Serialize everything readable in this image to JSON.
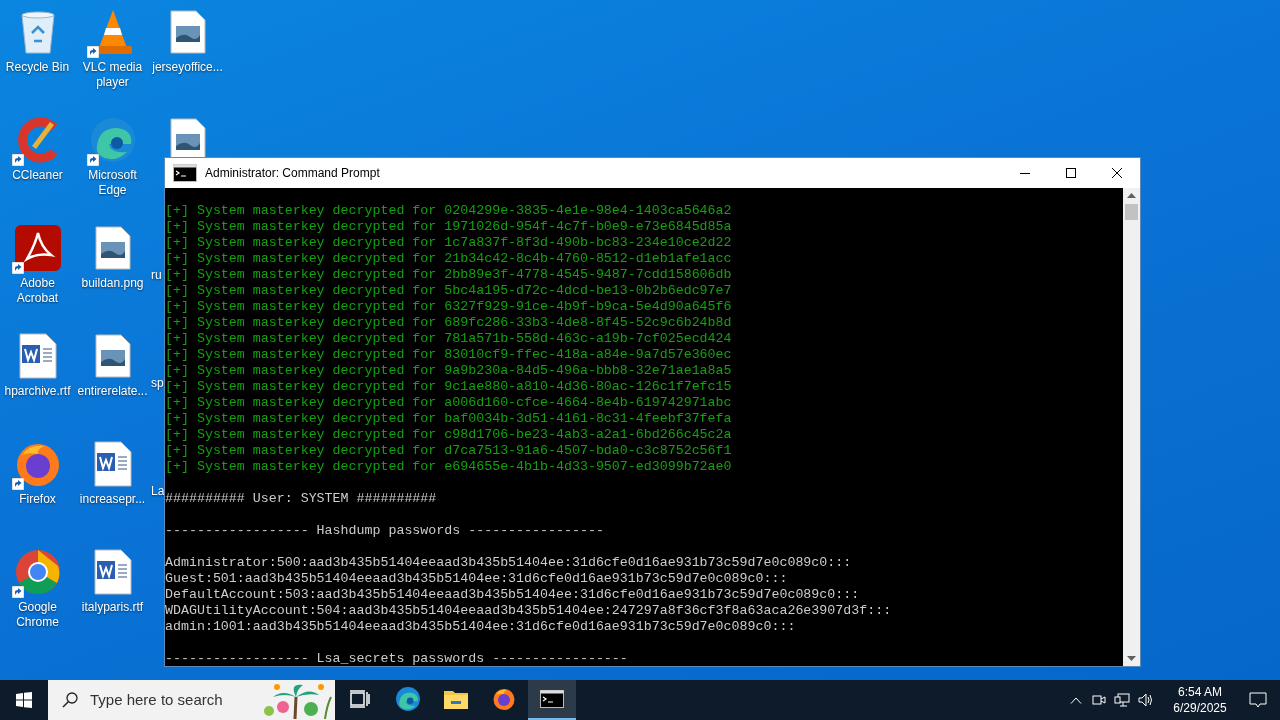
{
  "desktop": {
    "icons": [
      {
        "label": "Recycle Bin",
        "kind": "recycle",
        "shortcut": false
      },
      {
        "label": "CCleaner",
        "kind": "ccleaner",
        "shortcut": true
      },
      {
        "label": "Adobe Acrobat",
        "kind": "acrobat",
        "shortcut": true
      },
      {
        "label": "hparchive.rtf",
        "kind": "word",
        "shortcut": false
      },
      {
        "label": "Firefox",
        "kind": "firefox",
        "shortcut": true
      },
      {
        "label": "Google Chrome",
        "kind": "chrome",
        "shortcut": true
      },
      {
        "label": "VLC media player",
        "kind": "vlc",
        "shortcut": true
      },
      {
        "label": "Microsoft Edge",
        "kind": "edge",
        "shortcut": true
      },
      {
        "label": "buildan.png",
        "kind": "image",
        "shortcut": false
      },
      {
        "label": "entirerelate...",
        "kind": "image",
        "shortcut": false
      },
      {
        "label": "increasepr...",
        "kind": "word",
        "shortcut": false
      },
      {
        "label": "italyparis.rtf",
        "kind": "word",
        "shortcut": false
      },
      {
        "label": "jerseyoffice...",
        "kind": "image",
        "shortcut": false
      },
      {
        "kind": "image",
        "shortcut": false
      },
      {
        "label": "ru",
        "kind": "partial"
      },
      {
        "label": "sp",
        "kind": "partial"
      },
      {
        "label": "La",
        "kind": "partial"
      }
    ]
  },
  "window": {
    "title": "Administrator: Command Prompt",
    "lines": [
      {
        "kind": "green",
        "text": "[+] System masterkey decrypted for 0204299e-3835-4e1e-98e4-1403ca5646a2"
      },
      {
        "kind": "green",
        "text": "[+] System masterkey decrypted for 1971026d-954f-4c7f-b0e9-e73e6845d85a"
      },
      {
        "kind": "green",
        "text": "[+] System masterkey decrypted for 1c7a837f-8f3d-490b-bc83-234e10ce2d22"
      },
      {
        "kind": "green",
        "text": "[+] System masterkey decrypted for 21b34c42-8c4b-4760-8512-d1eb1afe1acc"
      },
      {
        "kind": "green",
        "text": "[+] System masterkey decrypted for 2bb89e3f-4778-4545-9487-7cdd158606db"
      },
      {
        "kind": "green",
        "text": "[+] System masterkey decrypted for 5bc4a195-d72c-4dcd-be13-0b2b6edc97e7"
      },
      {
        "kind": "green",
        "text": "[+] System masterkey decrypted for 6327f929-91ce-4b9f-b9ca-5e4d90a645f6"
      },
      {
        "kind": "green",
        "text": "[+] System masterkey decrypted for 689fc286-33b3-4de8-8f45-52c9c6b24b8d"
      },
      {
        "kind": "green",
        "text": "[+] System masterkey decrypted for 781a571b-558d-463c-a19b-7cf025ecd424"
      },
      {
        "kind": "green",
        "text": "[+] System masterkey decrypted for 83010cf9-ffec-418a-a84e-9a7d57e360ec"
      },
      {
        "kind": "green",
        "text": "[+] System masterkey decrypted for 9a9b230a-84d5-496a-bbb8-32e71ae1a8a5"
      },
      {
        "kind": "green",
        "text": "[+] System masterkey decrypted for 9c1ae880-a810-4d36-80ac-126c1f7efc15"
      },
      {
        "kind": "green",
        "text": "[+] System masterkey decrypted for a006d160-cfce-4664-8e4b-619742971abc"
      },
      {
        "kind": "green",
        "text": "[+] System masterkey decrypted for baf0034b-3d51-4161-8c31-4feebf37fefa"
      },
      {
        "kind": "green",
        "text": "[+] System masterkey decrypted for c98d1706-be23-4ab3-a2a1-6bd266c45c2a"
      },
      {
        "kind": "green",
        "text": "[+] System masterkey decrypted for d7ca7513-91a6-4507-bda0-c3c8752c56f1"
      },
      {
        "kind": "green",
        "text": "[+] System masterkey decrypted for e694655e-4b1b-4d33-9507-ed3099b72ae0"
      },
      {
        "kind": "blank"
      },
      {
        "kind": "white",
        "text": "########## User: SYSTEM ##########"
      },
      {
        "kind": "blank"
      },
      {
        "kind": "white",
        "text": "------------------ Hashdump passwords -----------------"
      },
      {
        "kind": "blank"
      },
      {
        "kind": "white",
        "text": "Administrator:500:aad3b435b51404eeaad3b435b51404ee:31d6cfe0d16ae931b73c59d7e0c089c0:::"
      },
      {
        "kind": "white",
        "text": "Guest:501:aad3b435b51404eeaad3b435b51404ee:31d6cfe0d16ae931b73c59d7e0c089c0:::"
      },
      {
        "kind": "white",
        "text": "DefaultAccount:503:aad3b435b51404eeaad3b435b51404ee:31d6cfe0d16ae931b73c59d7e0c089c0:::"
      },
      {
        "kind": "white",
        "text": "WDAGUtilityAccount:504:aad3b435b51404eeaad3b435b51404ee:247297a8f36cf3f8a63aca26e3907d3f:::"
      },
      {
        "kind": "white",
        "text": "admin:1001:aad3b435b51404eeaad3b435b51404ee:31d6cfe0d16ae931b73c59d7e0c089c0:::"
      },
      {
        "kind": "blank"
      },
      {
        "kind": "white",
        "text": "------------------ Lsa_secrets passwords -----------------"
      }
    ]
  },
  "taskbar": {
    "search": {
      "placeholder": "Type here to search"
    },
    "apps": [
      {
        "kind": "taskview",
        "selected": false
      },
      {
        "kind": "edge",
        "selected": false
      },
      {
        "kind": "explorer",
        "selected": false
      },
      {
        "kind": "firefox",
        "selected": false
      },
      {
        "kind": "cmd",
        "selected": true
      }
    ],
    "clock": {
      "time": "6:54 AM",
      "date": "6/29/2025"
    }
  }
}
